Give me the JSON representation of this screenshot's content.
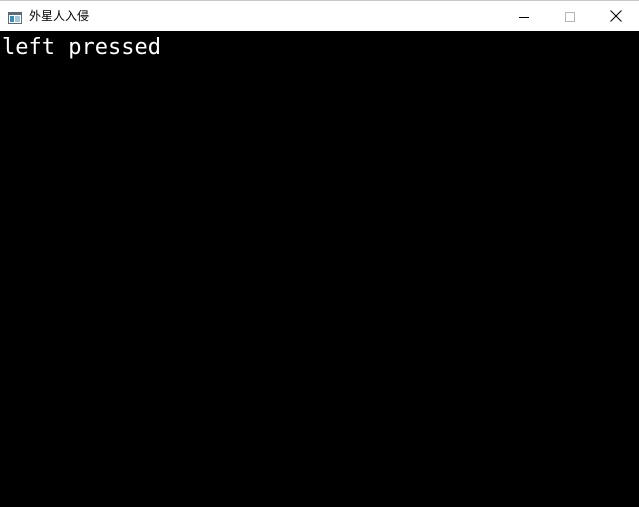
{
  "window": {
    "title": "外星人入侵",
    "icon": "app-window-icon",
    "buttons": {
      "minimize_icon": "minimize-icon",
      "maximize_icon": "maximize-icon",
      "close_icon": "close-icon"
    }
  },
  "canvas": {
    "background_color": "#000000",
    "text_color": "#ffffff",
    "status_text": "left pressed"
  }
}
